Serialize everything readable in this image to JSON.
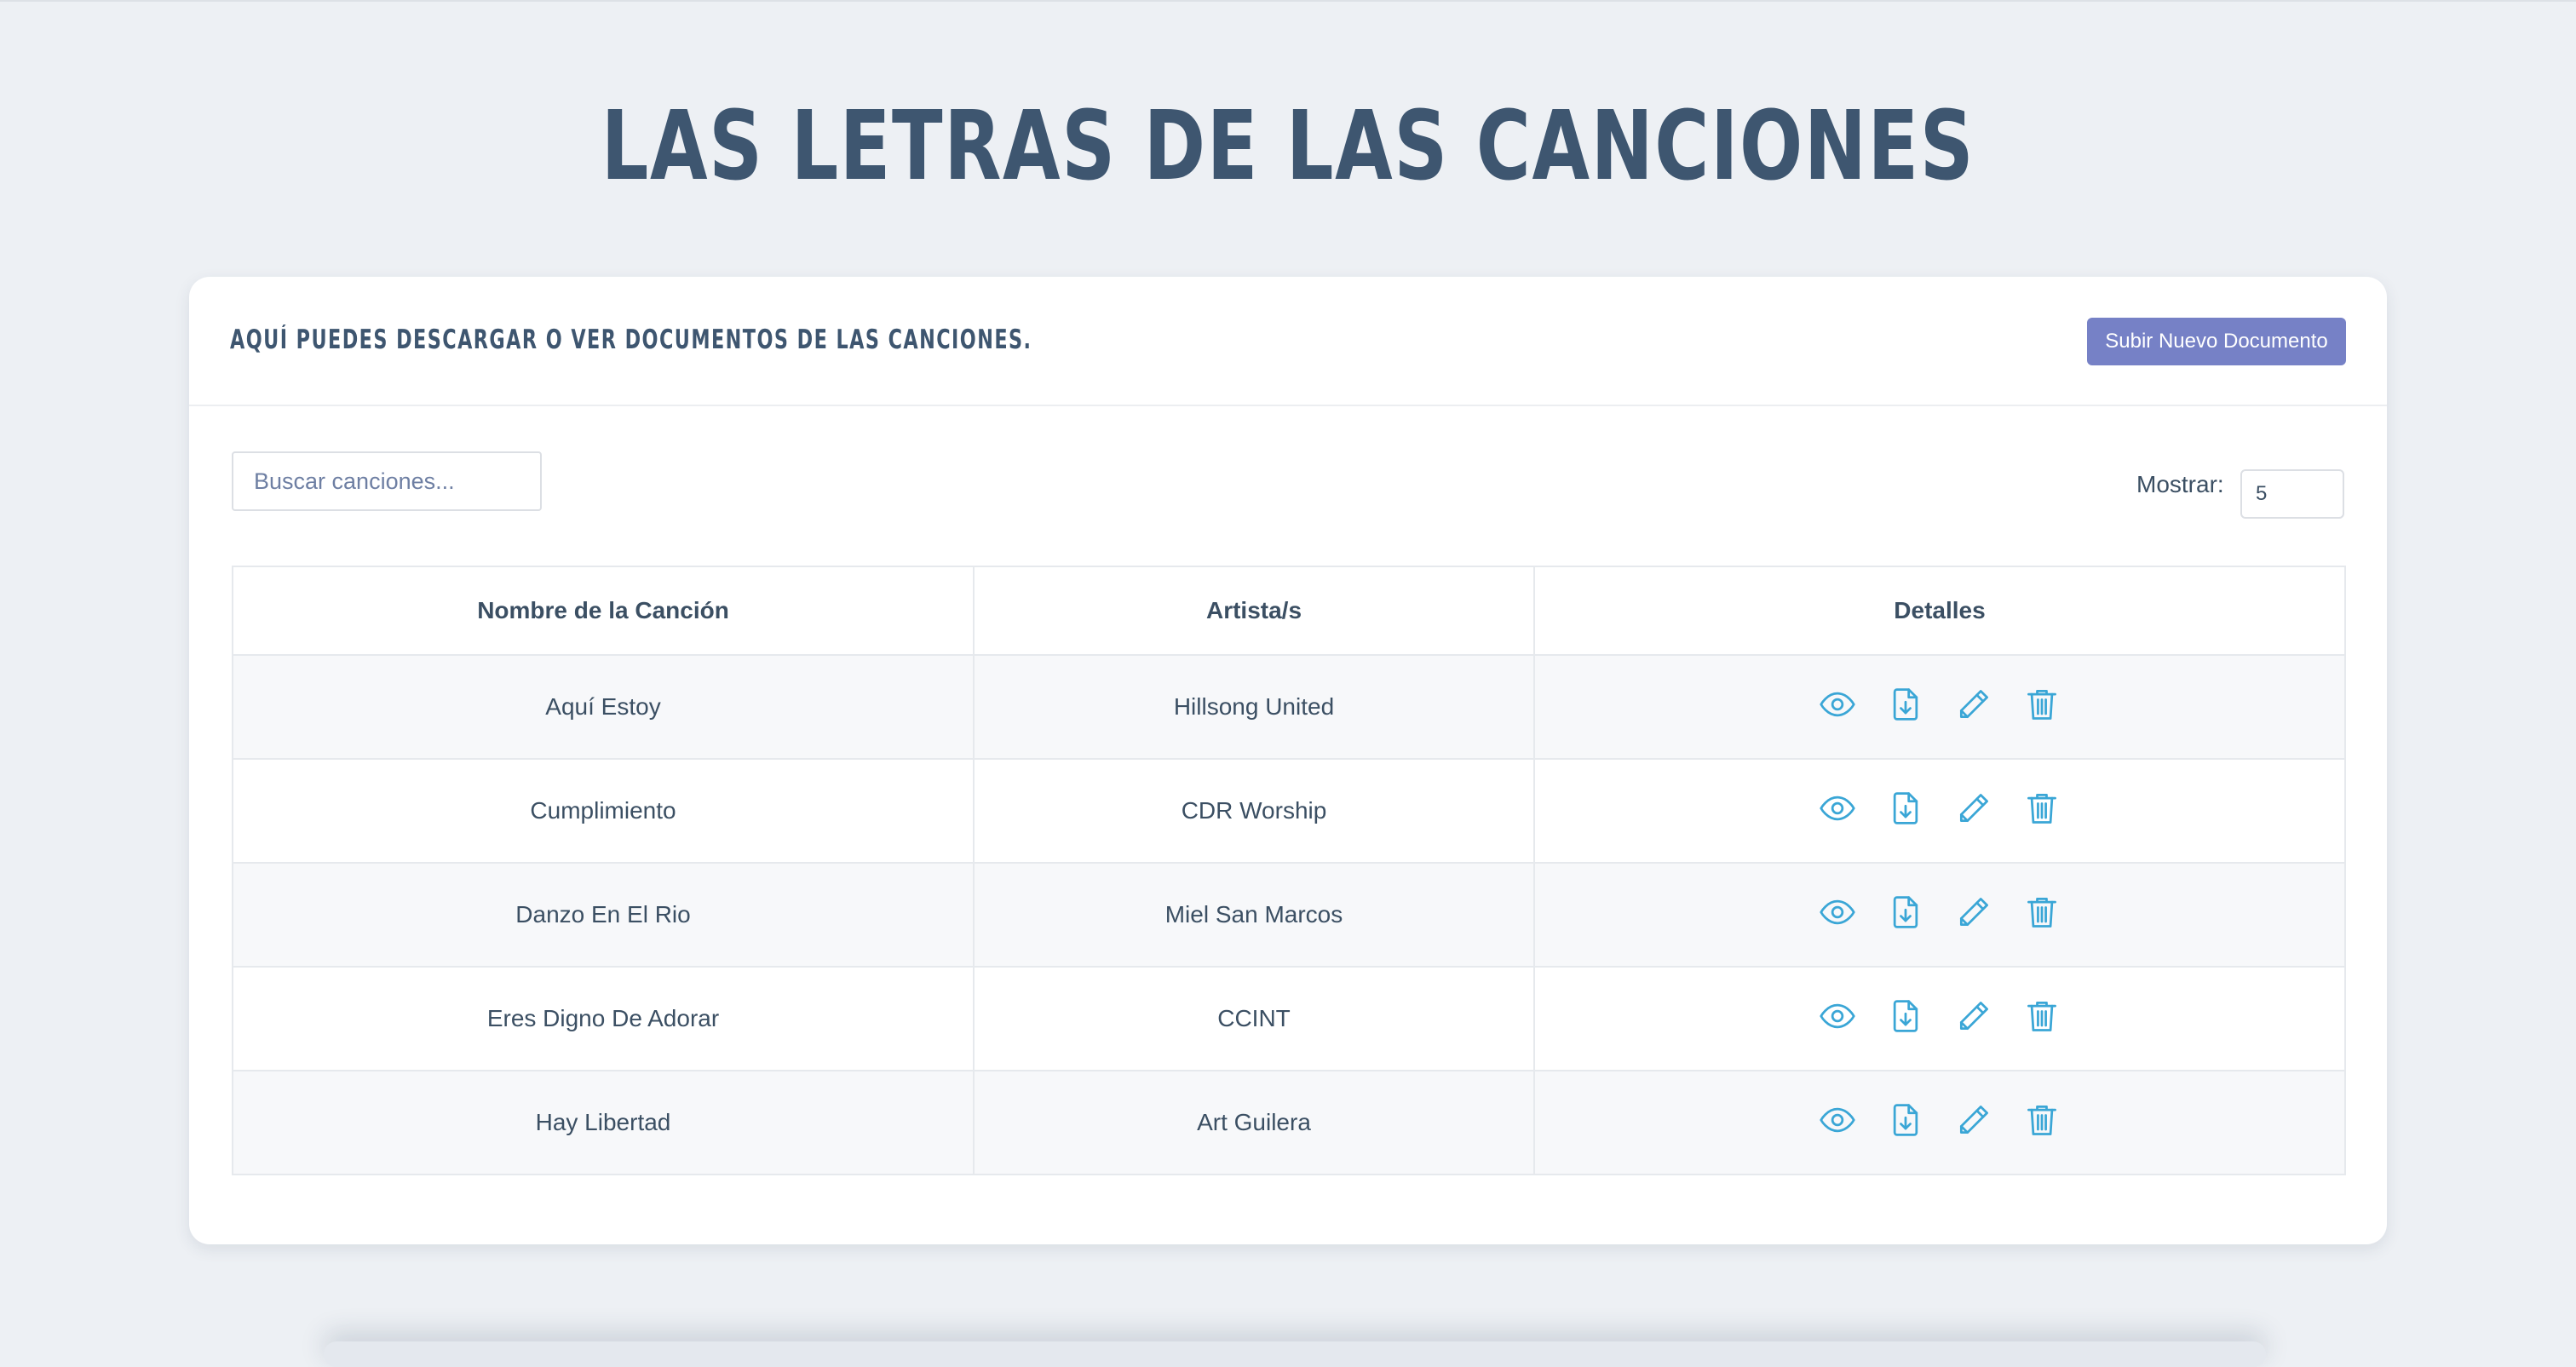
{
  "page": {
    "title": "LAS LETRAS DE LAS CANCIONES"
  },
  "card": {
    "subtitle": "AQUÍ PUEDES DESCARGAR O VER DOCUMENTOS DE LAS CANCIONES.",
    "upload_button": "Subir Nuevo Documento"
  },
  "controls": {
    "search_placeholder": "Buscar canciones...",
    "show_label": "Mostrar:",
    "show_value": "5"
  },
  "table": {
    "headers": [
      "Nombre de la Canción",
      "Artista/s",
      "Detalles"
    ],
    "rows": [
      {
        "song": "Aquí Estoy",
        "artist": "Hillsong United"
      },
      {
        "song": "Cumplimiento",
        "artist": "CDR Worship"
      },
      {
        "song": "Danzo En El Rio",
        "artist": "Miel San Marcos"
      },
      {
        "song": "Eres Digno De Adorar",
        "artist": "CCINT"
      },
      {
        "song": "Hay Libertad",
        "artist": "Art Guilera"
      }
    ],
    "actions": [
      "eye-icon",
      "file-download-icon",
      "pencil-icon",
      "trash-icon"
    ]
  },
  "colors": {
    "background": "#edf0f4",
    "title": "#3e5670",
    "button": "#7681c6",
    "icon": "#3aa6d6"
  }
}
